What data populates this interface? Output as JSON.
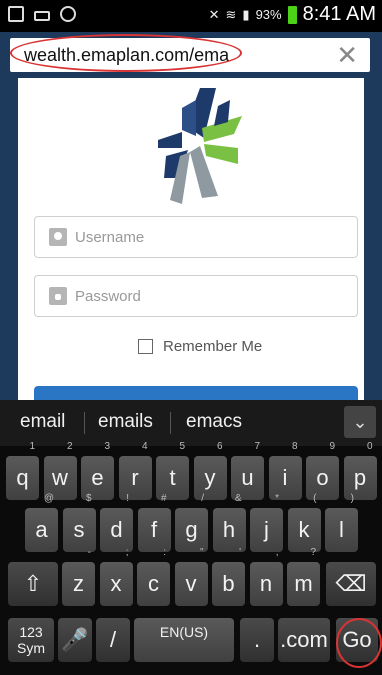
{
  "status": {
    "battery": "93%",
    "time": "8:41 AM"
  },
  "browser": {
    "url": "wealth.emaplan.com/ema",
    "clear_label": "✕"
  },
  "login": {
    "username_placeholder": "Username",
    "password_placeholder": "Password",
    "remember_label": "Remember Me"
  },
  "suggestions": [
    "email",
    "emails",
    "emacs"
  ],
  "keyboard": {
    "row1": [
      {
        "k": "q",
        "s": "1"
      },
      {
        "k": "w",
        "s": "2"
      },
      {
        "k": "e",
        "s": "3"
      },
      {
        "k": "r",
        "s": "4"
      },
      {
        "k": "t",
        "s": "5"
      },
      {
        "k": "y",
        "s": "6"
      },
      {
        "k": "u",
        "s": "7"
      },
      {
        "k": "i",
        "s": "8"
      },
      {
        "k": "o",
        "s": "9"
      },
      {
        "k": "p",
        "s": "0"
      }
    ],
    "row2": [
      {
        "k": "a",
        "s": "@"
      },
      {
        "k": "s",
        "s": "$"
      },
      {
        "k": "d",
        "s": "!"
      },
      {
        "k": "f",
        "s": "#"
      },
      {
        "k": "g",
        "s": "/"
      },
      {
        "k": "h",
        "s": "&"
      },
      {
        "k": "j",
        "s": "*"
      },
      {
        "k": "k",
        "s": "("
      },
      {
        "k": "l",
        "s": ")"
      }
    ],
    "row3": [
      {
        "k": "z",
        "s": "-"
      },
      {
        "k": "x",
        "s": ";"
      },
      {
        "k": "c",
        "s": ":"
      },
      {
        "k": "v",
        "s": "\""
      },
      {
        "k": "b",
        "s": "'"
      },
      {
        "k": "n",
        "s": ","
      },
      {
        "k": "m",
        "s": "?"
      }
    ],
    "sym_label": "123\nSym",
    "slash_label": "/",
    "lang_label": "EN(US)",
    "dot_label": ".",
    "com_label": ".com",
    "go_label": "Go"
  }
}
